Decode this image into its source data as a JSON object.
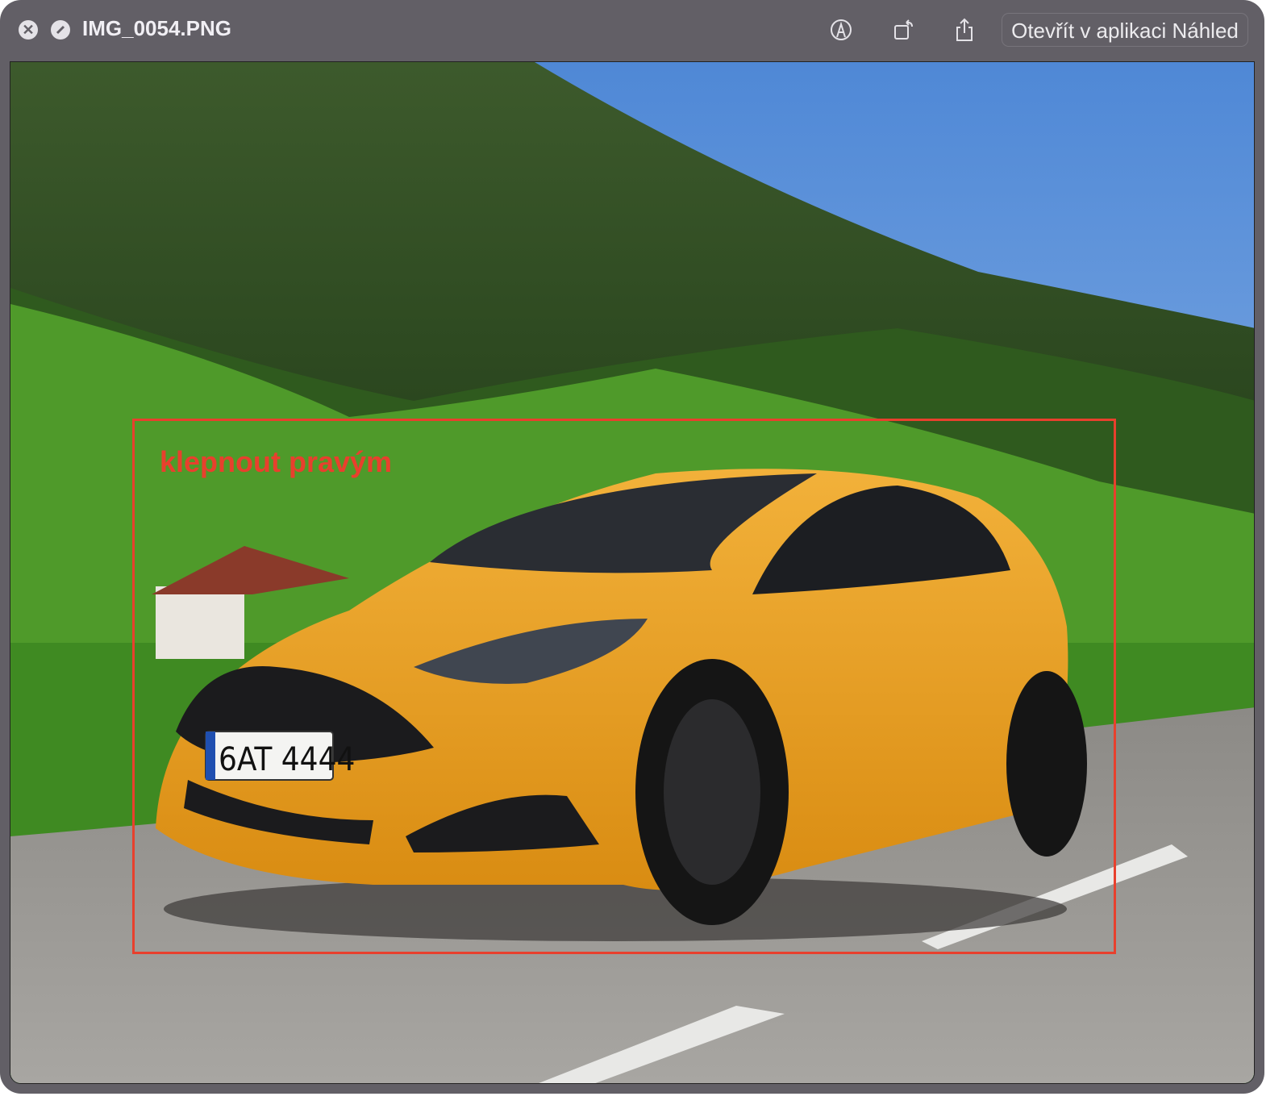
{
  "window": {
    "title": "IMG_0054.PNG",
    "open_button_label": "Otevřít v aplikaci Náhled"
  },
  "toolbar": {
    "icons": [
      "close-icon",
      "fullscreen-icon",
      "markup-icon",
      "rotate-icon",
      "share-icon"
    ]
  },
  "image": {
    "annotation_text": "klepnout pravým",
    "annotation_color": "#e8402d",
    "license_plate": "6AT 4444"
  },
  "overlay": {
    "live_text_icon": "live-text-icon"
  }
}
